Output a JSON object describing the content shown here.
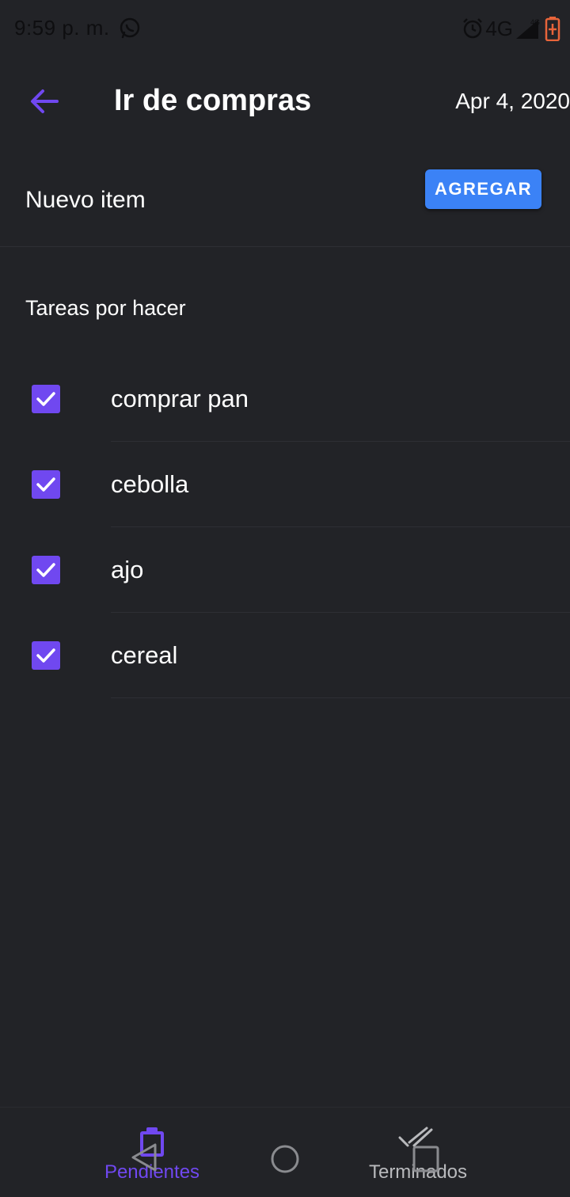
{
  "status_bar": {
    "time": "9:59 p. m.",
    "network": "4G",
    "icons": [
      "whatsapp-icon",
      "alarm-icon",
      "signal-icon",
      "battery-charging-icon"
    ],
    "battery_color": "#e8643a"
  },
  "app_bar": {
    "back_icon": "arrow-left-icon",
    "title": "Ir de compras",
    "date": "Apr 4, 2020"
  },
  "new_item": {
    "placeholder": "Nuevo item",
    "value": "",
    "add_button_label": "AGREGAR"
  },
  "section": {
    "title": "Tareas por hacer"
  },
  "tasks": [
    {
      "label": "comprar pan",
      "checked": true
    },
    {
      "label": "cebolla",
      "checked": true
    },
    {
      "label": "ajo",
      "checked": true
    },
    {
      "label": "cereal",
      "checked": true
    }
  ],
  "bottom_nav": {
    "tabs": [
      {
        "label": "Pendientes",
        "icon": "clipboard-icon",
        "active": true
      },
      {
        "label": "Terminados",
        "icon": "done-all-icon",
        "active": false
      }
    ]
  },
  "system_nav": [
    "back-triangle-icon",
    "home-circle-icon",
    "recents-square-icon"
  ],
  "colors": {
    "background": "#222327",
    "accent": "#7048f0",
    "button": "#3b82f6",
    "text": "#ffffff",
    "inactive_tab": "#b9babd"
  }
}
